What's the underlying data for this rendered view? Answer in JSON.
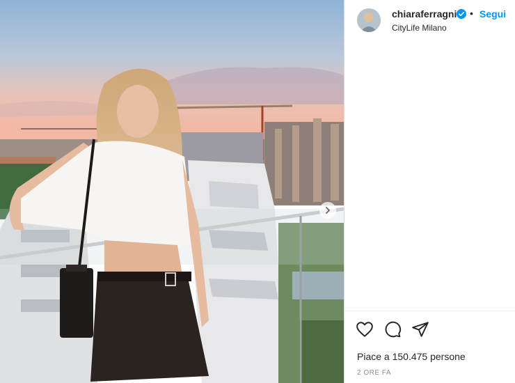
{
  "post": {
    "username": "chiaraferragni",
    "separator": "•",
    "follow_label": "Segui",
    "location": "CityLife Milano",
    "likes_text": "Piace a 150.475 persone",
    "time_text": "2 ORE FA"
  },
  "icons": {
    "verified": "verified-badge-icon",
    "like": "heart-icon",
    "comment": "comment-icon",
    "share": "send-icon",
    "next": "chevron-right-icon"
  },
  "colors": {
    "accent": "#0095f6",
    "text": "#262626",
    "muted": "#8e8e8e",
    "border": "#dbdbdb"
  }
}
